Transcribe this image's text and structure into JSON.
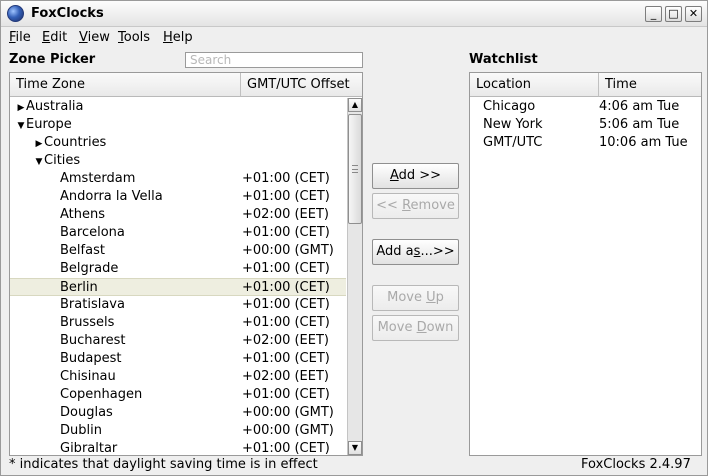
{
  "window": {
    "title": "FoxClocks",
    "controls": {
      "minimize": "_",
      "maximize": "□",
      "close": "✕"
    }
  },
  "menu": [
    {
      "pre": "",
      "mnemonic": "F",
      "post": "ile"
    },
    {
      "pre": "",
      "mnemonic": "E",
      "post": "dit"
    },
    {
      "pre": "",
      "mnemonic": "V",
      "post": "iew"
    },
    {
      "pre": "",
      "mnemonic": "T",
      "post": "ools"
    },
    {
      "pre": "",
      "mnemonic": "H",
      "post": "elp"
    }
  ],
  "zone_picker": {
    "title": "Zone Picker",
    "search_placeholder": "Search",
    "columns": {
      "zone": "Time Zone",
      "offset": "GMT/UTC Offset"
    },
    "rows": [
      {
        "name": "Australia",
        "offset": "",
        "indent": 0,
        "toggle": "▶"
      },
      {
        "name": "Europe",
        "offset": "",
        "indent": 0,
        "toggle": "▼"
      },
      {
        "name": "Countries",
        "offset": "",
        "indent": 1,
        "toggle": "▶"
      },
      {
        "name": "Cities",
        "offset": "",
        "indent": 1,
        "toggle": "▼"
      },
      {
        "name": "Amsterdam",
        "offset": "+01:00 (CET)",
        "indent": 2,
        "toggle": ""
      },
      {
        "name": "Andorra la Vella",
        "offset": "+01:00 (CET)",
        "indent": 2,
        "toggle": ""
      },
      {
        "name": "Athens",
        "offset": "+02:00 (EET)",
        "indent": 2,
        "toggle": ""
      },
      {
        "name": "Barcelona",
        "offset": "+01:00 (CET)",
        "indent": 2,
        "toggle": ""
      },
      {
        "name": "Belfast",
        "offset": "+00:00 (GMT)",
        "indent": 2,
        "toggle": ""
      },
      {
        "name": "Belgrade",
        "offset": "+01:00 (CET)",
        "indent": 2,
        "toggle": ""
      },
      {
        "name": "Berlin",
        "offset": "+01:00 (CET)",
        "indent": 2,
        "toggle": "",
        "selected": true
      },
      {
        "name": "Bratislava",
        "offset": "+01:00 (CET)",
        "indent": 2,
        "toggle": ""
      },
      {
        "name": "Brussels",
        "offset": "+01:00 (CET)",
        "indent": 2,
        "toggle": ""
      },
      {
        "name": "Bucharest",
        "offset": "+02:00 (EET)",
        "indent": 2,
        "toggle": ""
      },
      {
        "name": "Budapest",
        "offset": "+01:00 (CET)",
        "indent": 2,
        "toggle": ""
      },
      {
        "name": "Chisinau",
        "offset": "+02:00 (EET)",
        "indent": 2,
        "toggle": ""
      },
      {
        "name": "Copenhagen",
        "offset": "+01:00 (CET)",
        "indent": 2,
        "toggle": ""
      },
      {
        "name": "Douglas",
        "offset": "+00:00 (GMT)",
        "indent": 2,
        "toggle": ""
      },
      {
        "name": "Dublin",
        "offset": "+00:00 (GMT)",
        "indent": 2,
        "toggle": ""
      },
      {
        "name": "Gibraltar",
        "offset": "+01:00 (CET)",
        "indent": 2,
        "toggle": ""
      }
    ]
  },
  "buttons": {
    "add": {
      "pre": "",
      "mnemonic": "A",
      "post": "dd >>"
    },
    "remove": {
      "pre": "<< ",
      "mnemonic": "R",
      "post": "emove"
    },
    "add_as": {
      "pre": "Add a",
      "mnemonic": "s",
      "post": "...>>"
    },
    "move_up": {
      "pre": "Move ",
      "mnemonic": "U",
      "post": "p"
    },
    "move_down": {
      "pre": "Move ",
      "mnemonic": "D",
      "post": "own"
    }
  },
  "watchlist": {
    "title": "Watchlist",
    "columns": {
      "location": "Location",
      "time": "Time"
    },
    "rows": [
      {
        "location": "Chicago",
        "time": "4:06 am Tue"
      },
      {
        "location": "New York",
        "time": "5:06 am Tue"
      },
      {
        "location": "GMT/UTC",
        "time": "10:06 am Tue"
      }
    ]
  },
  "status": {
    "note": "* indicates that daylight saving time is in effect",
    "version": "FoxClocks 2.4.97"
  }
}
